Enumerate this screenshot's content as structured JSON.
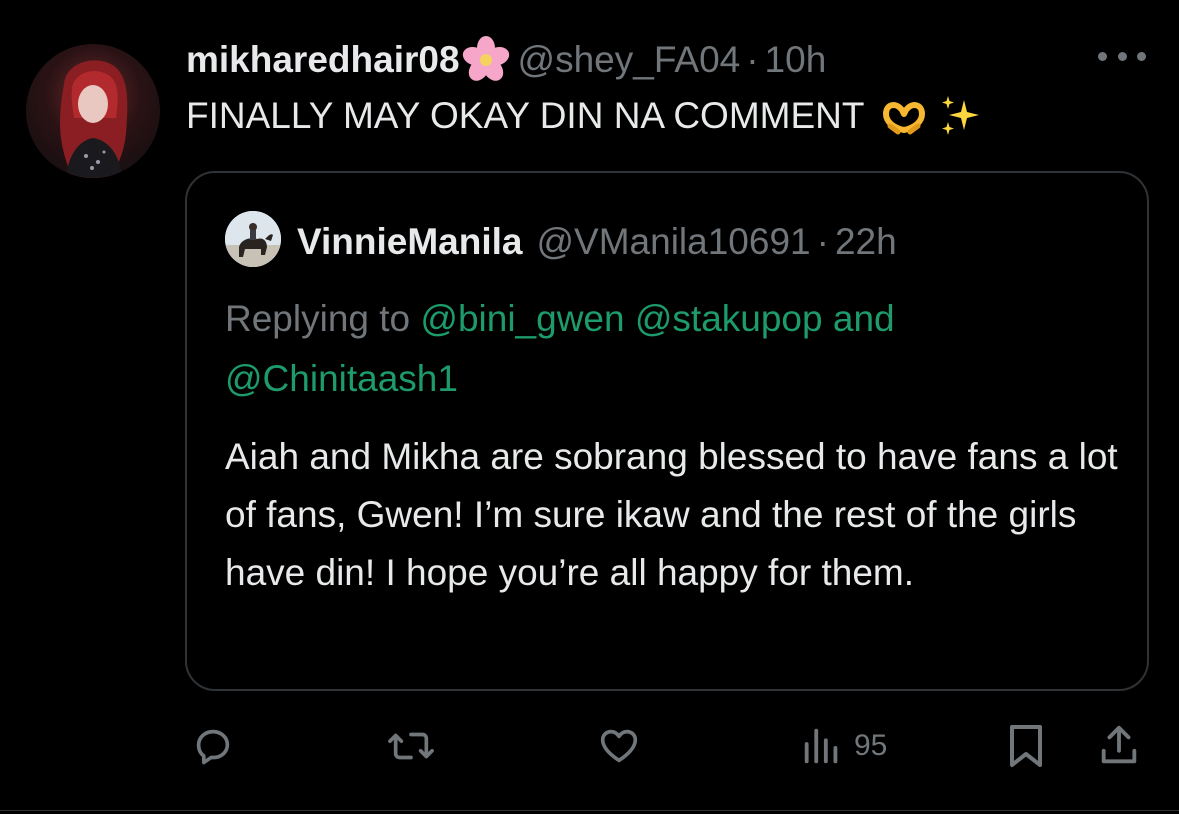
{
  "author": {
    "display_name": "mikharedhair08",
    "handle": "@shey_FA04",
    "separator": "·",
    "time": "10h",
    "avatar_icon": "avatar-red-hair"
  },
  "tweet": {
    "text": "FINALLY MAY OKAY DIN NA COMMENT",
    "emojis": [
      "heart-hands-emoji",
      "sparkles-emoji"
    ]
  },
  "quote": {
    "display_name": "VinnieManila",
    "handle": "@VManila10691",
    "separator": "·",
    "time": "22h",
    "replying_prefix": "Replying to",
    "mention_1": "@bini_gwen",
    "mention_2": "@stakupop",
    "and_word": "and",
    "mention_3": "@Chinitaash1",
    "body": "Aiah and Mikha are sobrang blessed to have fans a lot of fans, Gwen! I’m sure ikaw and the rest of the girls have din! I hope you’re all happy for them."
  },
  "actions": {
    "reply_icon": "reply-icon",
    "retweet_icon": "retweet-icon",
    "like_icon": "like-icon",
    "views_icon": "views-icon",
    "views_count": "95",
    "bookmark_icon": "bookmark-icon",
    "share_icon": "share-icon"
  },
  "colors": {
    "background": "#000000",
    "text": "#e7e9ea",
    "muted": "#71767b",
    "mention": "#1d9b6b",
    "border": "#2f3336"
  }
}
